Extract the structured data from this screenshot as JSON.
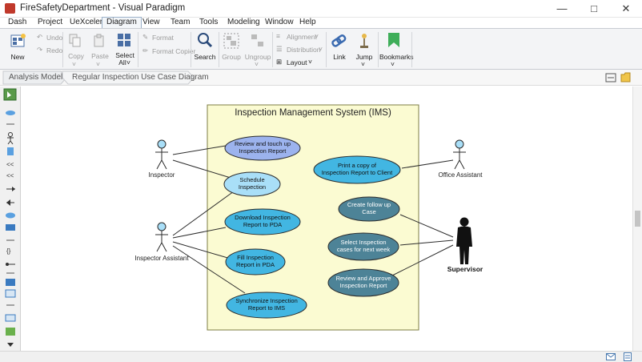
{
  "window": {
    "title": "FireSafetyDepartment - Visual Paradigm"
  },
  "menu": {
    "tabs": [
      "Dash",
      "Project",
      "UeXceler",
      "Diagram",
      "View",
      "Team",
      "Tools",
      "Modeling",
      "Window",
      "Help"
    ],
    "active": "Diagram"
  },
  "toolbar": {
    "new": "New",
    "undo": "Undo",
    "redo": "Redo",
    "copy": "Copy",
    "paste": "Paste",
    "select": "Select",
    "select_all": "All",
    "format": "Format",
    "format_copier": "Format Copier",
    "search": "Search",
    "group": "Group",
    "ungroup": "Ungroup",
    "alignment": "Alignment",
    "distribution": "Distribution",
    "layout": "Layout",
    "link": "Link",
    "jump": "Jump",
    "bookmarks": "Bookmarks"
  },
  "breadcrumb": [
    "Analysis Model",
    "Regular Inspection Use Case Diagram"
  ],
  "diagram": {
    "system_name": "Inspection Management System (IMS)",
    "actors": {
      "inspector": "Inspector",
      "inspector_assistant": "Inspector Assistant",
      "office_assistant": "Office Assistant",
      "supervisor": "Supervisor"
    },
    "use_cases": [
      {
        "line1": "Review and touch up",
        "line2": "Inspection Report"
      },
      {
        "line1": "Schedule",
        "line2": "Inspection"
      },
      {
        "line1": "Download Inspection",
        "line2": "Report to PDA"
      },
      {
        "line1": "Fill Inspection",
        "line2": "Report in PDA"
      },
      {
        "line1": "Synchronize Inspection",
        "line2": "Report to IMS"
      },
      {
        "line1": "Print a copy of",
        "line2": "Inspection Report to Client"
      },
      {
        "line1": "Create follow up",
        "line2": "Case"
      },
      {
        "line1": "Select Inspection",
        "line2": "cases for next week"
      },
      {
        "line1": "Review and Approve",
        "line2": "Inspection Report"
      }
    ]
  },
  "colors": {
    "system_fill": "#fbfbd2",
    "system_border": "#7c7c44",
    "uc_light": "#a9dff8",
    "uc_medium": "#42b6e2",
    "uc_dark": "#4d8397",
    "uc_highlight": "#9cb3ee",
    "accent": "#2b579a"
  }
}
